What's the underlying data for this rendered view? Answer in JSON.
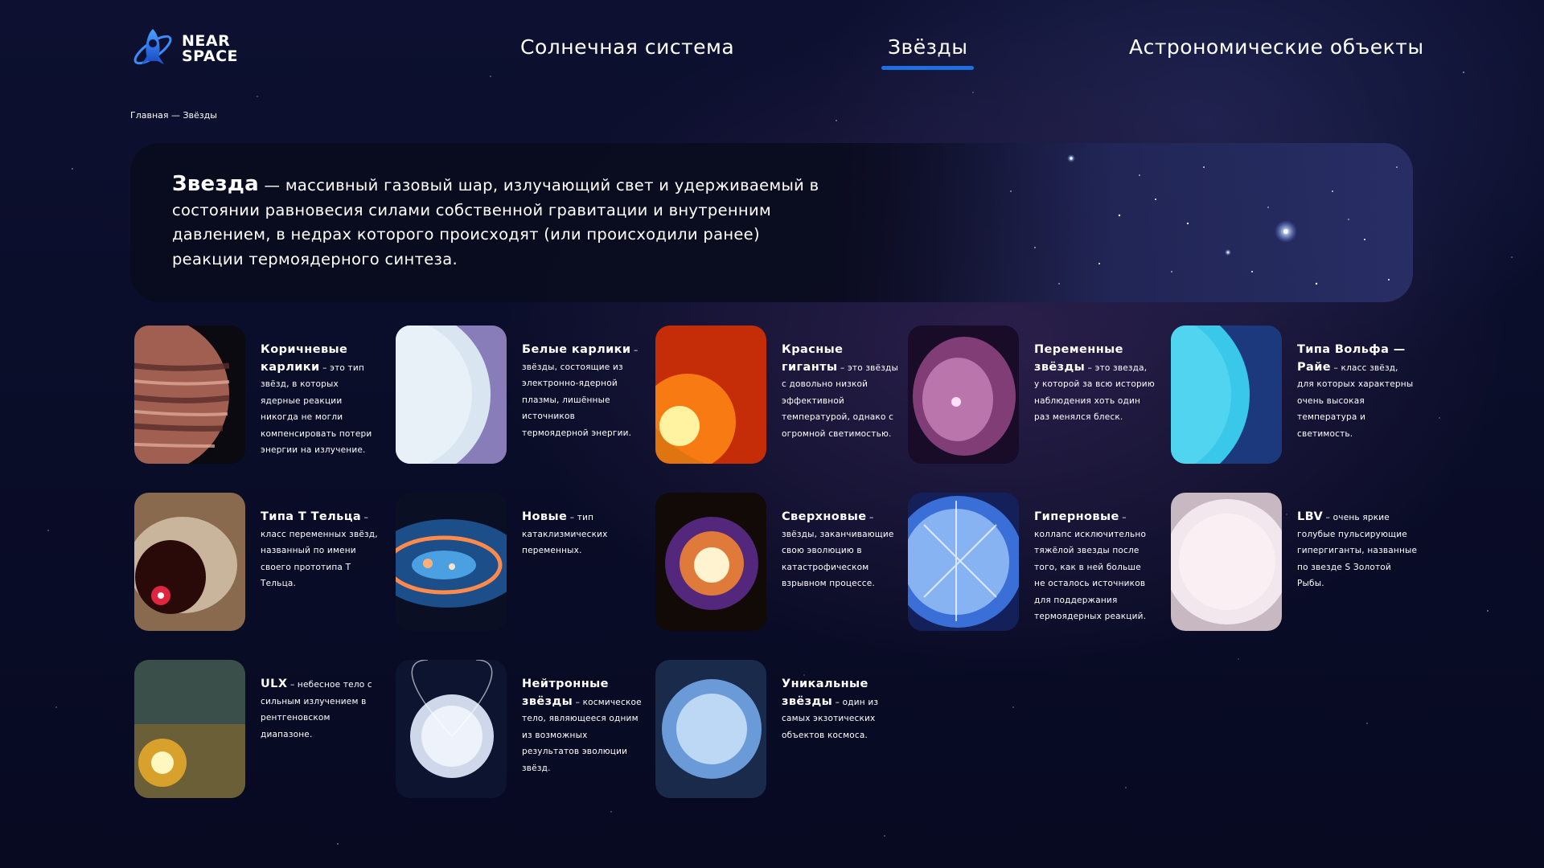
{
  "logo": {
    "line1": "NEAR",
    "line2": "SPACE"
  },
  "nav": {
    "solar": "Солнечная система",
    "stars": "Звёзды",
    "objects": "Астрономические объекты"
  },
  "breadcrumb": "Главная — Звёзды",
  "hero": {
    "term": "Звезда",
    "definition": " — массивный газовый шар, излучающий свет и удерживаемый в состоянии равновесия силами собственной гравитации и внутренним давлением, в недрах которого происходят (или происходили ранее) реакции термоядерного синтеза."
  },
  "cards": [
    {
      "title": "Коричневые карлики",
      "text": " – это тип звёзд, в которых ядерные реакции никогда не могли компенсировать потери энергии на излучение."
    },
    {
      "title": "Белые карлики",
      "text": " – звёзды, состоящие из электронно-ядерной плазмы, лишённые источников термоядерной энергии."
    },
    {
      "title": "Красные гиганты",
      "text": " – это звёзды с довольно низкой эффективной температурой, однако с огромной светимостью."
    },
    {
      "title": "Переменные звёзды",
      "text": " – это звезда, у которой за всю историю наблюдения хоть один раз менялся блеск."
    },
    {
      "title": "Типа Вольфа — Райе",
      "text": " – класс звёзд, для которых характерны очень высокая температура и светимость."
    },
    {
      "title": "Типа Т Тельца",
      "text": " – класс переменных звёзд, названный по имени своего прототипа Т Тельца."
    },
    {
      "title": "Новые",
      "text": " – тип катаклизмических переменных."
    },
    {
      "title": "Сверхновые",
      "text": " – звёзды, заканчивающие свою эволюцию в катастрофическом взрывном процессе."
    },
    {
      "title": "Гиперновые",
      "text": " – коллапс исключительно тяжёлой звезды после того, как в ней больше не осталось источников для поддержания термоядерных реакций."
    },
    {
      "title": "LBV",
      "text": " – очень яркие голубые пульсирующие гипергиганты, названные по звезде S Золотой Рыбы."
    },
    {
      "title": "ULX",
      "text": " – небесное тело с сильным излучением в рентгеновском диапазоне."
    },
    {
      "title": "Нейтронные звёзды",
      "text": " – космическое тело, являющееся одним из возможных результатов эволюции звёзд."
    },
    {
      "title": "Уникальные звёзды",
      "text": " – один из самых экзотических объектов космоса."
    }
  ]
}
